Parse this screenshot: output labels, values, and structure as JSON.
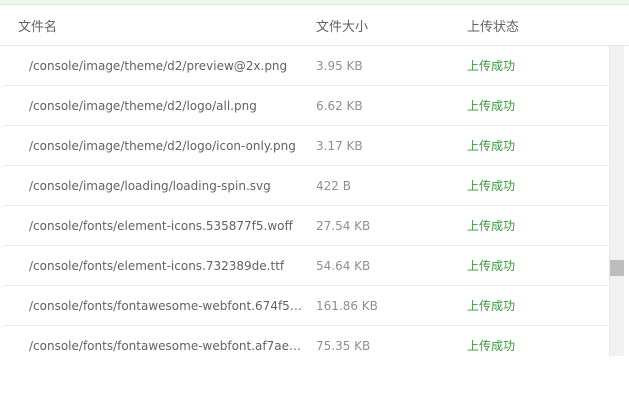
{
  "table": {
    "headers": {
      "name": "文件名",
      "size": "文件大小",
      "status": "上传状态"
    },
    "rows": [
      {
        "name": "/console/image/theme/d2/preview@2x.png",
        "size": "3.95 KB",
        "status": "上传成功"
      },
      {
        "name": "/console/image/theme/d2/logo/all.png",
        "size": "6.62 KB",
        "status": "上传成功"
      },
      {
        "name": "/console/image/theme/d2/logo/icon-only.png",
        "size": "3.17 KB",
        "status": "上传成功"
      },
      {
        "name": "/console/image/loading/loading-spin.svg",
        "size": "422 B",
        "status": "上传成功"
      },
      {
        "name": "/console/fonts/element-icons.535877f5.woff",
        "size": "27.54 KB",
        "status": "上传成功"
      },
      {
        "name": "/console/fonts/element-icons.732389de.ttf",
        "size": "54.64 KB",
        "status": "上传成功"
      },
      {
        "name": "/console/fonts/fontawesome-webfont.674f50...",
        "size": "161.86 KB",
        "status": "上传成功"
      },
      {
        "name": "/console/fonts/fontawesome-webfont.af7ae50...",
        "size": "75.35 KB",
        "status": "上传成功"
      }
    ]
  },
  "colors": {
    "success": "#3a9b3a",
    "header_text": "#606266",
    "size_text": "#8b8f96"
  }
}
